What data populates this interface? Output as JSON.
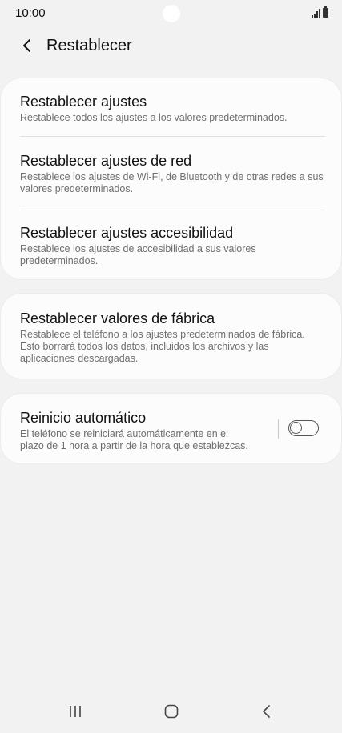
{
  "status_bar": {
    "time": "10:00",
    "icons": [
      "camera-cutout",
      "signal-icon",
      "battery-icon"
    ]
  },
  "header": {
    "back_icon": "chevron-left-icon",
    "title": "Restablecer"
  },
  "reset_group": {
    "items": [
      {
        "title": "Restablecer ajustes",
        "description": "Restablece todos los ajustes a los valores predeterminados."
      },
      {
        "title": "Restablecer ajustes de red",
        "description": "Restablece los ajustes de Wi-Fi, de Bluetooth y de otras redes a sus valores predeterminados."
      },
      {
        "title": "Restablecer ajustes accesibilidad",
        "description": "Restablece los ajustes de accesibilidad a sus valores predeterminados."
      }
    ]
  },
  "factory_reset": {
    "title": "Restablecer valores de fábrica",
    "description": "Restablece el teléfono a los ajustes predeterminados de fábrica. Esto borrará todos los datos, incluidos los archivos y las aplicaciones descargadas."
  },
  "auto_restart": {
    "title": "Reinicio automático",
    "description": "El teléfono se reiniciará automáticamente en el plazo de 1 hora a partir de la hora que establezcas.",
    "toggle_on": false
  },
  "nav_bar": {
    "icons": [
      "recent-apps-icon",
      "home-icon",
      "back-icon"
    ]
  },
  "colors": {
    "background": "#f2f2f2",
    "card": "#fcfcfc",
    "text_primary": "#111111",
    "text_secondary": "#6f6f6f"
  }
}
